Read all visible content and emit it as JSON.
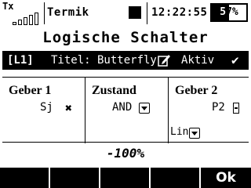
{
  "status_bar": {
    "tx_label": "Tx",
    "model_name": "Termik",
    "time": "12:22:55",
    "battery": {
      "percent_text_black": "5",
      "percent_text_white": "7%",
      "level": 0.57
    }
  },
  "page": {
    "title": "Logische Schalter"
  },
  "selected_row": {
    "id": "[L1]",
    "title_label": "Titel: Butterfly",
    "status": "Aktiv",
    "check": "✔"
  },
  "columns": {
    "geber1": {
      "title": "Geber 1",
      "value": "Sj",
      "clear_icon": "✖"
    },
    "zustand": {
      "title": "Zustand",
      "value": "AND"
    },
    "geber2": {
      "title": "Geber 2",
      "value": "P2",
      "mode": "Lin"
    }
  },
  "result_value": "-100%",
  "softkeys": [
    "",
    "",
    "",
    "",
    "Ok"
  ],
  "icons": {
    "signal": "signal-strength-icon",
    "stop": "stop-square-icon",
    "battery": "battery-icon",
    "edit": "edit-pencil-icon",
    "dropdown": "dropdown-arrow-icon",
    "switch": "proportional-switch-icon"
  }
}
